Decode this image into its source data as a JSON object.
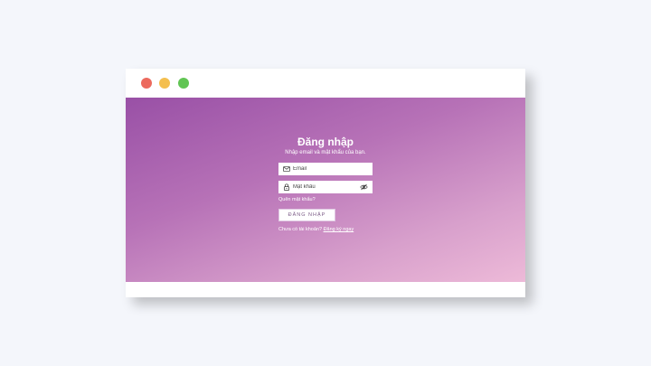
{
  "window": {
    "controls": [
      {
        "name": "close",
        "color": "#ec6a5e"
      },
      {
        "name": "minimize",
        "color": "#f4bf4f"
      },
      {
        "name": "maximize",
        "color": "#61c554"
      }
    ]
  },
  "login": {
    "title": "Đăng nhập",
    "subtitle": "Nhập email và mật khẩu của bạn.",
    "email_placeholder": "Email",
    "password_placeholder": "Mật khẩu",
    "forgot_password": "Quên mật khẩu?",
    "submit_label": "ĐĂNG NHẬP",
    "signup_prompt": "Chưa có tài khoản?",
    "signup_link": "Đăng ký ngay",
    "icons": {
      "email": "mail-icon",
      "password": "lock-icon",
      "toggle": "eye-off-icon"
    }
  },
  "colors": {
    "gradient_start": "#9950a6",
    "gradient_end": "#edbad8",
    "page_background": "#f4f6fb"
  }
}
